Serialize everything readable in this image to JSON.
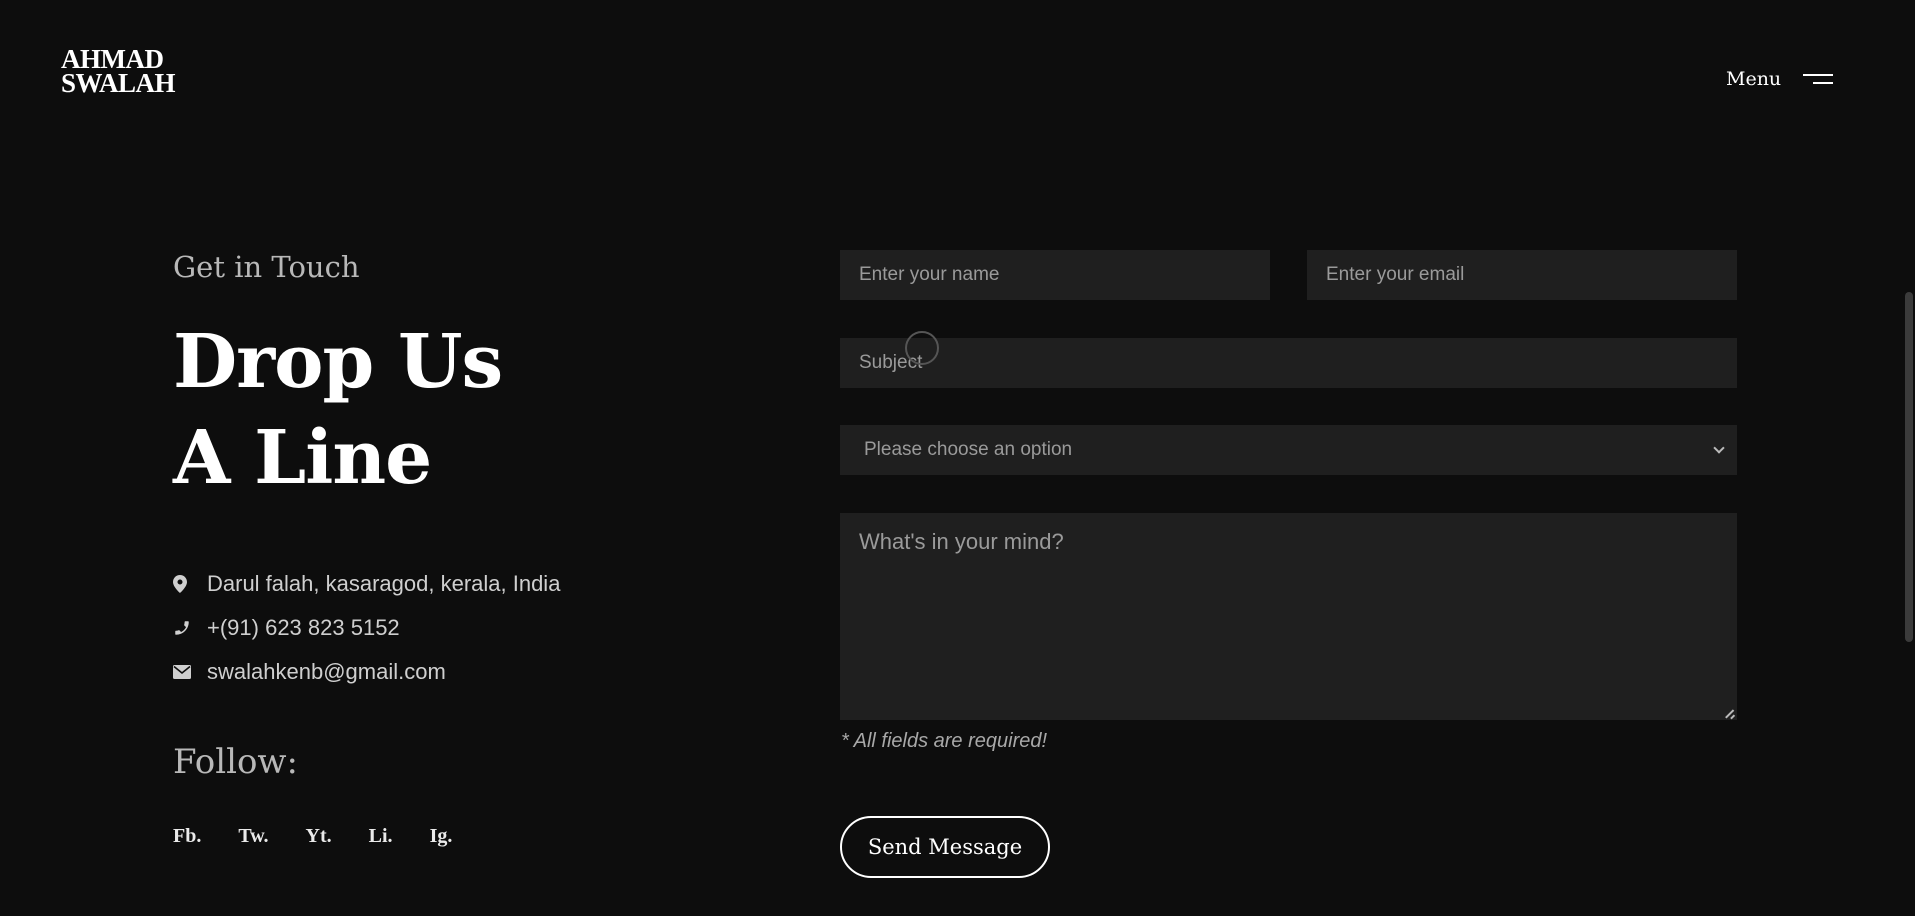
{
  "header": {
    "logo_line1": "AHMAD",
    "logo_line2": "SWALAH",
    "menu_label": "Menu"
  },
  "contact_info": {
    "kicker": "Get in Touch",
    "headline_line1": "Drop Us",
    "headline_line2": "A Line",
    "address": "Darul falah, kasaragod, kerala, India",
    "phone": "+(91) 623 823 5152",
    "email": "swalahkenb@gmail.com",
    "follow_label": "Follow:",
    "social": [
      "Fb.",
      "Tw.",
      "Yt.",
      "Li.",
      "Ig."
    ]
  },
  "form": {
    "name_placeholder": "Enter your name",
    "email_placeholder": "Enter your email",
    "subject_placeholder": "Subject",
    "select_value": "Please choose an option",
    "message_placeholder": "What's in your mind?",
    "required_note": "* All fields are required!",
    "submit_label": "Send Message"
  },
  "icons": {
    "address": "map-pin-icon",
    "phone": "phone-icon",
    "email": "envelope-icon",
    "menu": "hamburger-icon"
  },
  "colors": {
    "background": "#0d0d0d",
    "field_background": "#1f1f1f",
    "text": "#ffffff",
    "muted_text": "#b8b8b8"
  }
}
